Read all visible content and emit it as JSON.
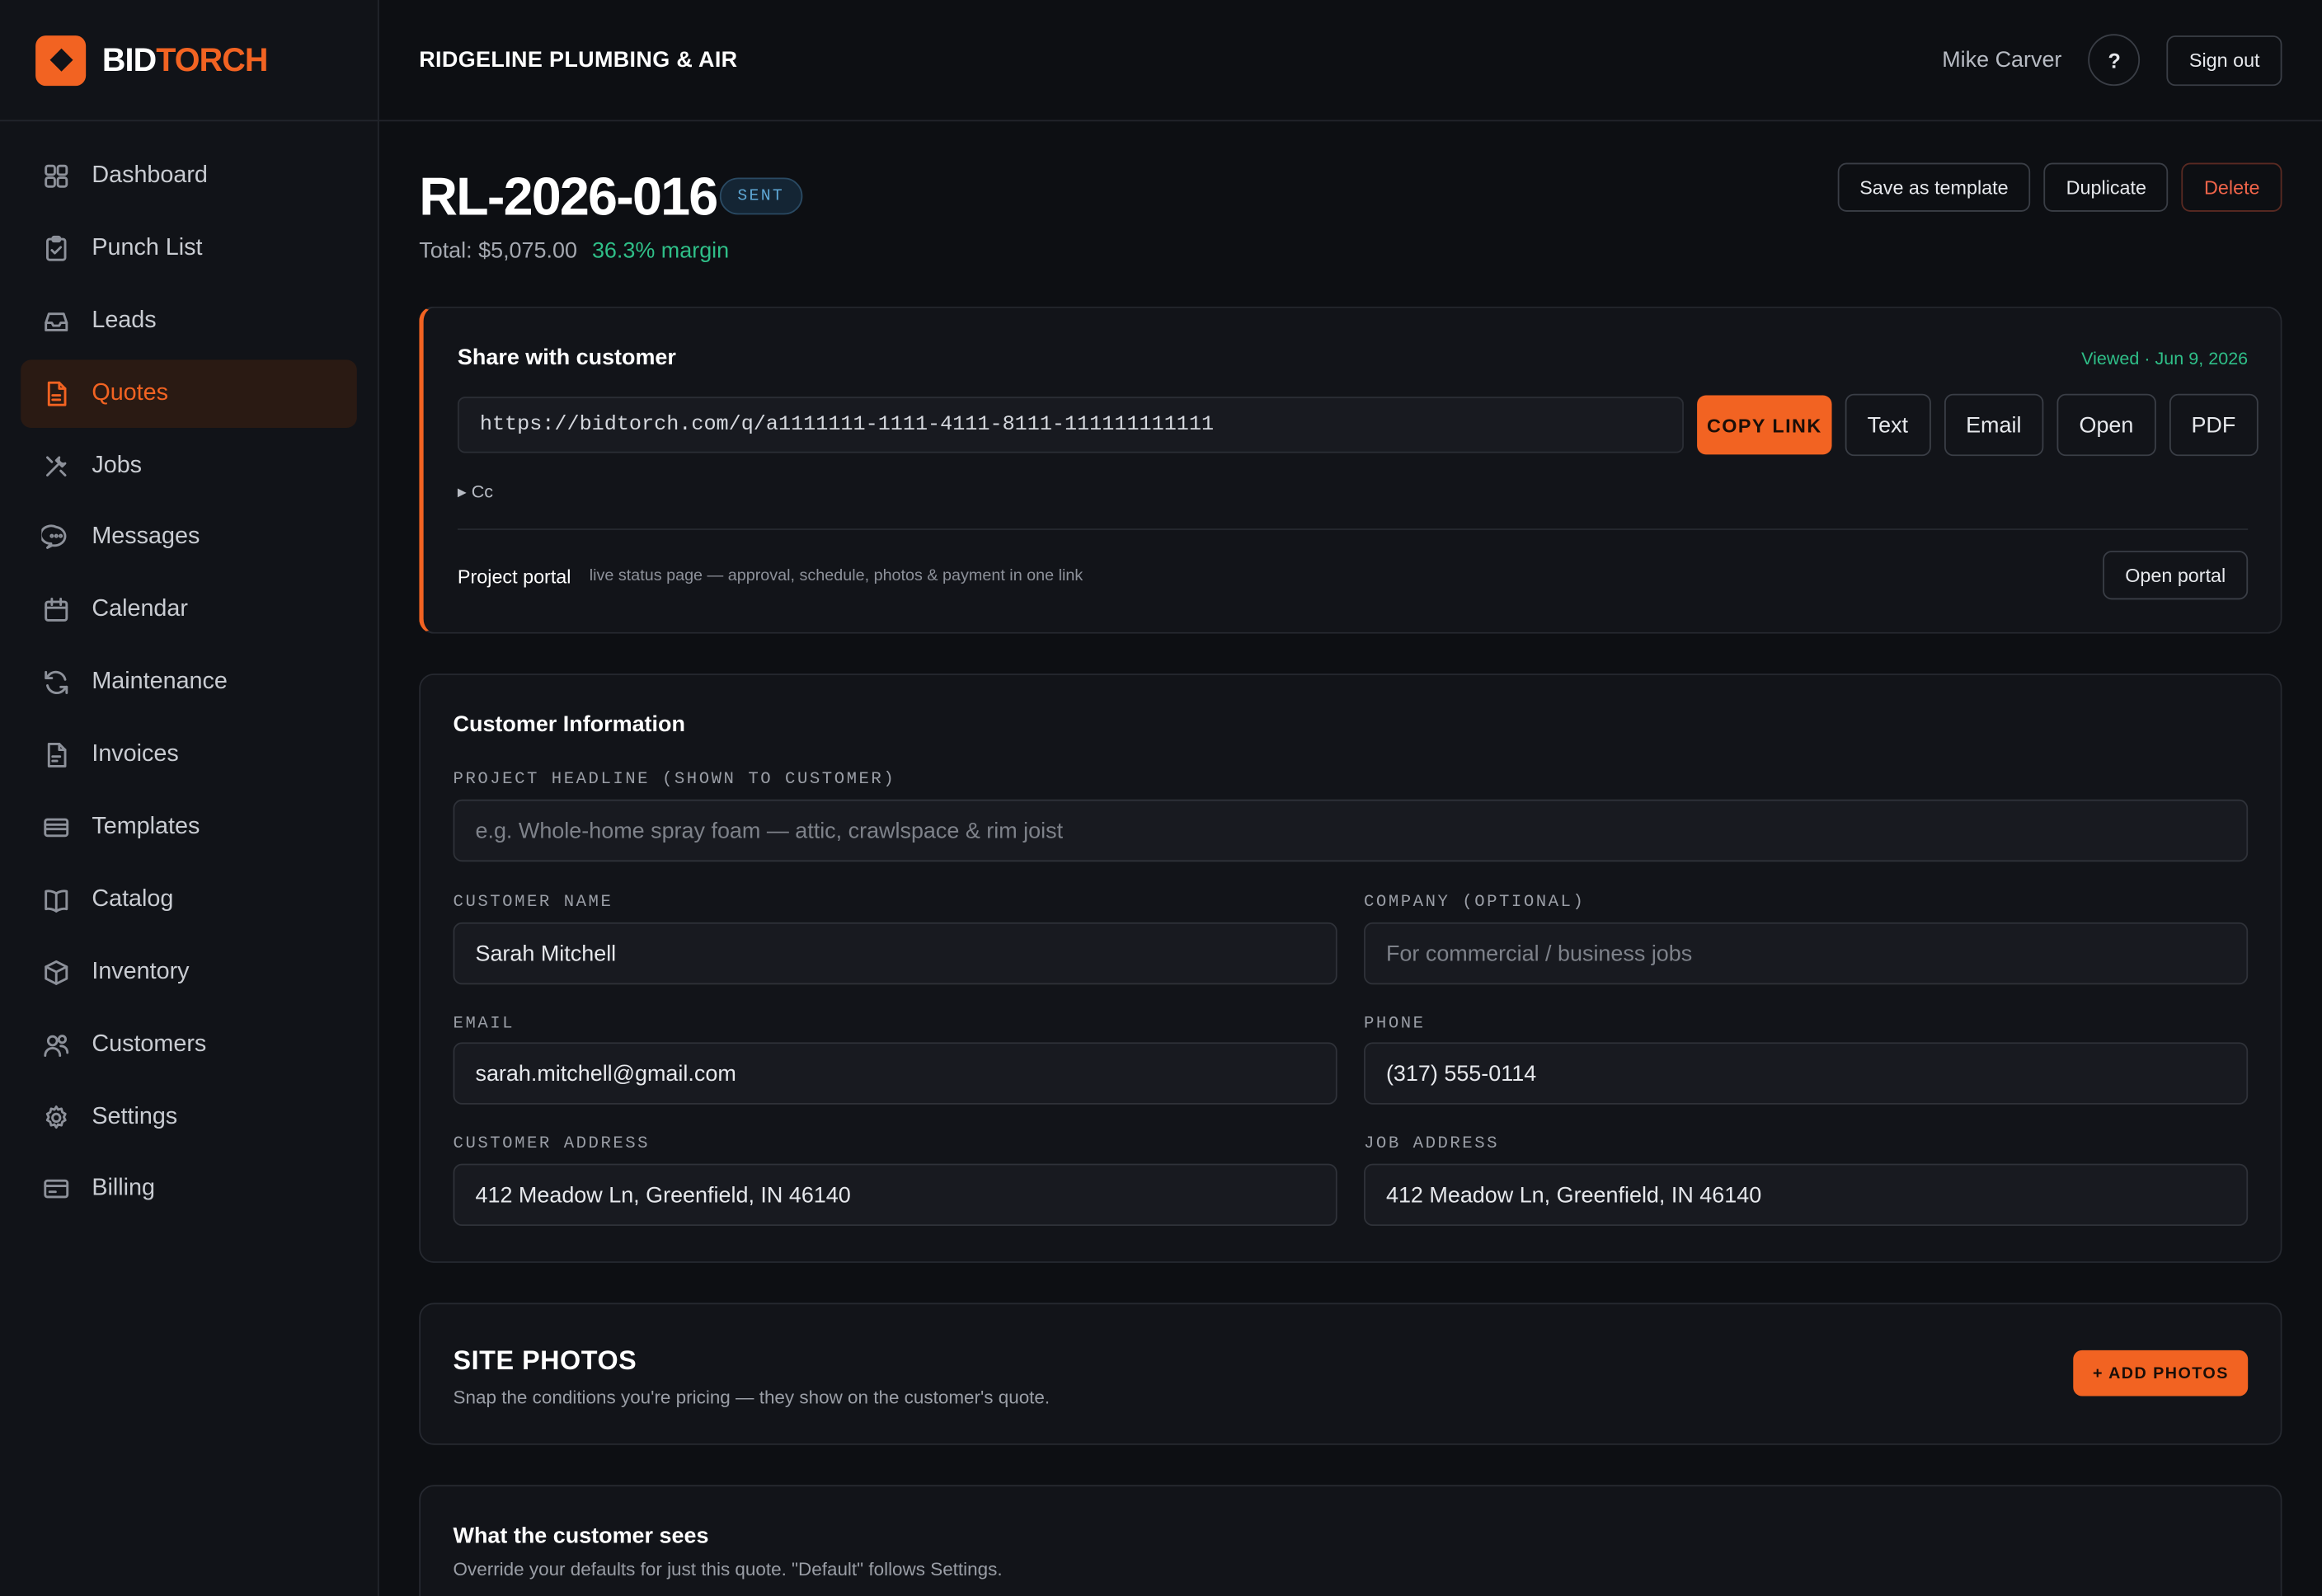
{
  "brand": {
    "part1": "BID",
    "part2": "TORCH"
  },
  "header": {
    "company": "RIDGELINE PLUMBING & AIR",
    "user": "Mike Carver",
    "help": "?",
    "signout": "Sign out"
  },
  "sidebar": {
    "items": [
      {
        "label": "Dashboard",
        "icon": "grid-icon"
      },
      {
        "label": "Punch List",
        "icon": "clipboard-check-icon"
      },
      {
        "label": "Leads",
        "icon": "inbox-icon"
      },
      {
        "label": "Quotes",
        "icon": "document-icon",
        "active": true
      },
      {
        "label": "Jobs",
        "icon": "tools-icon"
      },
      {
        "label": "Messages",
        "icon": "chat-icon"
      },
      {
        "label": "Calendar",
        "icon": "calendar-icon"
      },
      {
        "label": "Maintenance",
        "icon": "refresh-icon"
      },
      {
        "label": "Invoices",
        "icon": "file-icon"
      },
      {
        "label": "Templates",
        "icon": "layers-icon"
      },
      {
        "label": "Catalog",
        "icon": "book-icon"
      },
      {
        "label": "Inventory",
        "icon": "box-icon"
      },
      {
        "label": "Customers",
        "icon": "users-icon"
      },
      {
        "label": "Settings",
        "icon": "gear-icon"
      },
      {
        "label": "Billing",
        "icon": "credit-card-icon"
      }
    ]
  },
  "quote": {
    "number": "RL-2026-016",
    "status": "SENT",
    "total": "Total: $5,075.00",
    "margin": "36.3% margin",
    "actions": {
      "save_template": "Save as template",
      "duplicate": "Duplicate",
      "delete": "Delete"
    }
  },
  "share": {
    "title": "Share with customer",
    "viewed": "Viewed · Jun 9, 2026",
    "url": "https://bidtorch.com/q/a1111111-1111-4111-8111-111111111111",
    "copy": "COPY LINK",
    "buttons": [
      "Text",
      "Email",
      "Open",
      "PDF"
    ],
    "cc": "▸ Cc",
    "portal_label": "Project portal",
    "portal_desc": "live status page — approval, schedule, photos & payment in one link",
    "portal_button": "Open portal"
  },
  "customer": {
    "title": "Customer Information",
    "headline_label": "PROJECT HEADLINE (SHOWN TO CUSTOMER)",
    "headline_placeholder": "e.g. Whole-home spray foam — attic, crawlspace & rim joist",
    "name_label": "CUSTOMER NAME",
    "name_value": "Sarah Mitchell",
    "company_label": "COMPANY (OPTIONAL)",
    "company_placeholder": "For commercial / business jobs",
    "email_label": "EMAIL",
    "email_value": "sarah.mitchell@gmail.com",
    "phone_label": "PHONE",
    "phone_value": "(317) 555-0114",
    "address_label": "CUSTOMER ADDRESS",
    "address_value": "412 Meadow Ln, Greenfield, IN 46140",
    "job_address_label": "JOB ADDRESS",
    "job_address_value": "412 Meadow Ln, Greenfield, IN 46140"
  },
  "photos": {
    "title": "SITE PHOTOS",
    "subtitle": "Snap the conditions you're pricing — they show on the customer's quote.",
    "add": "+ ADD PHOTOS"
  },
  "sees": {
    "title": "What the customer sees",
    "subtitle": "Override your defaults for just this quote. \"Default\" follows Settings."
  },
  "colors": {
    "accent": "#f26322",
    "success": "#2fbf88",
    "danger": "#f0644a",
    "background": "#0d0f13"
  }
}
